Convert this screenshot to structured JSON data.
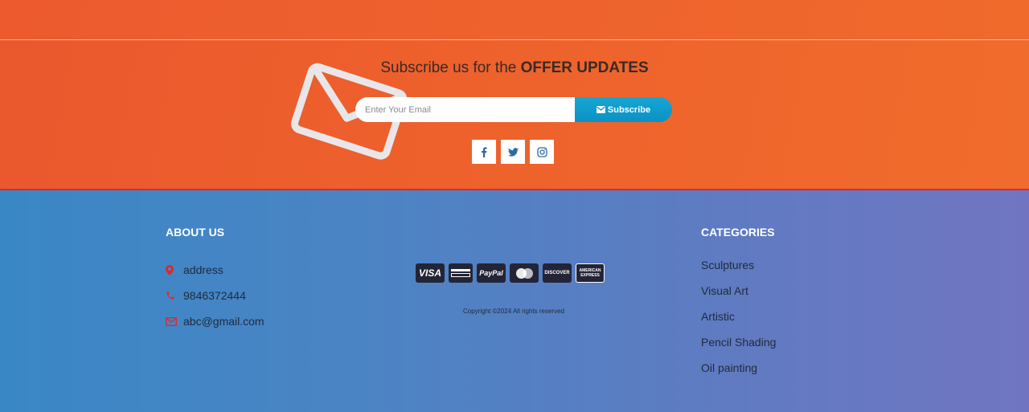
{
  "subscribe": {
    "title_prefix": "Subscribe us for the ",
    "title_bold": "OFFER UPDATES",
    "email_placeholder": "Enter Your Email",
    "button_label": "Subscribe",
    "social": [
      "facebook-icon",
      "twitter-icon",
      "instagram-icon"
    ]
  },
  "about": {
    "title": "ABOUT US",
    "address": "address",
    "phone": "9846372444",
    "email": "abc@gmail.com"
  },
  "payments": [
    "VISA",
    "CARD",
    "PayPal",
    "MasterCard",
    "DISCOVER",
    "AMERICAN EXPRESS"
  ],
  "copyright": "Copyright ©2024 All rights reserved",
  "categories": {
    "title": "CATEGORIES",
    "items": [
      "Sculptures",
      "Visual Art",
      "Artistic",
      "Pencil Shading",
      "Oil painting"
    ]
  },
  "colors": {
    "orange": "#ee612c",
    "accent_blue": "#0b9bd0",
    "icon_red": "#e0282c",
    "footer_start": "#3a87c6",
    "footer_end": "#7175c1"
  }
}
